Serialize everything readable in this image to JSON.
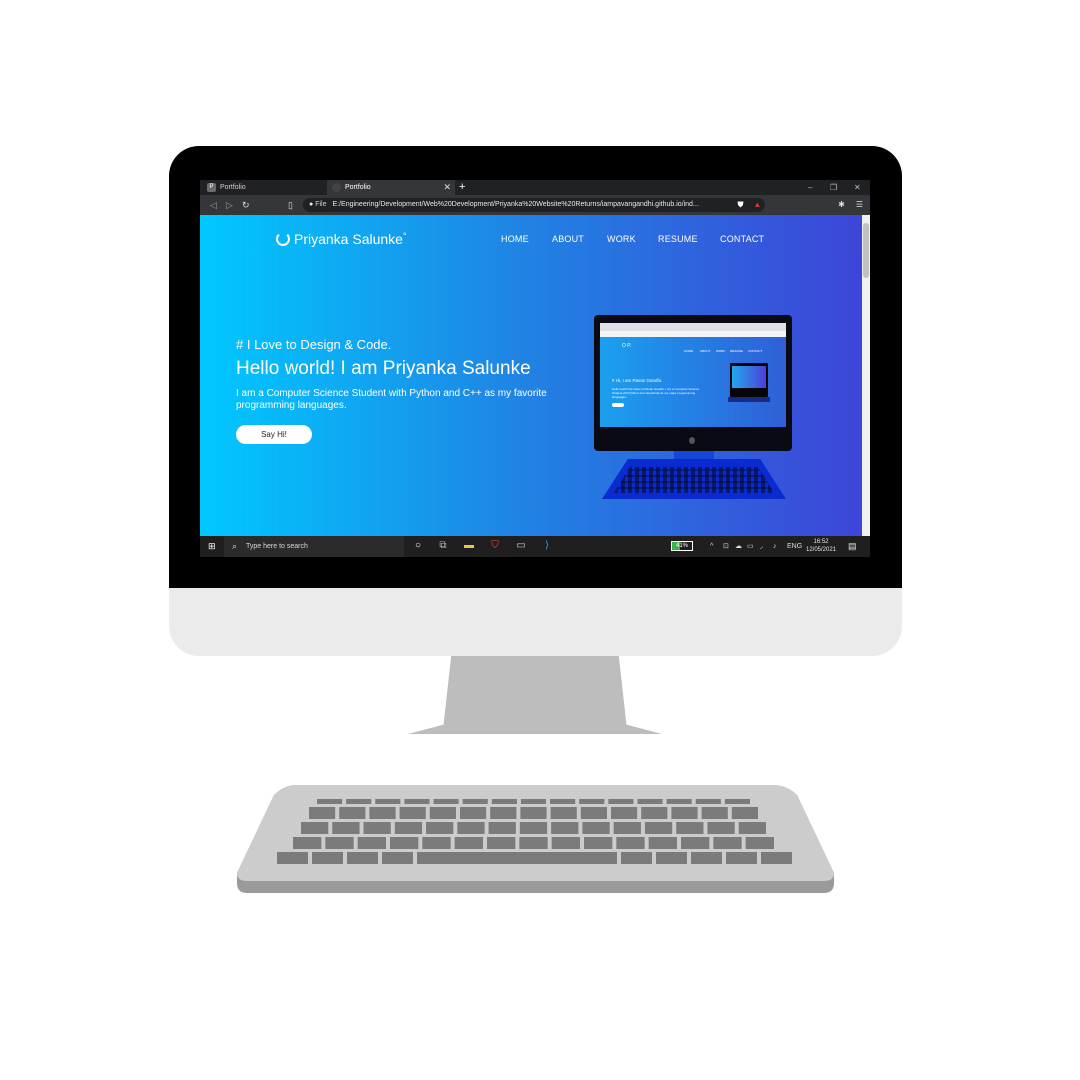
{
  "browser": {
    "tabs": [
      {
        "label": "Portfolio",
        "active": false
      },
      {
        "label": "Portfolio",
        "active": true
      }
    ],
    "new_tab": "+",
    "address": {
      "scheme_label": "File",
      "url": "E:/Engineering/Development/Web%20Development/Priyanka%20Website%20Returns/iampavangandhi.github.io/ind..."
    },
    "window_controls": [
      "–",
      "❐",
      "✕"
    ]
  },
  "page": {
    "logo": "Priyanka Salunke",
    "logo_suffix": "°",
    "nav": [
      "HOME",
      "ABOUT",
      "WORK",
      "RESUME",
      "CONTACT"
    ],
    "hero": {
      "kicker": "# I Love to Design & Code.",
      "title": "Hello world! I am Priyanka Salunke",
      "description": "I am a Computer Science Student with Python and C++ as my favorite programming languages.",
      "button": "Say Hi!"
    },
    "preview": {
      "kicker": "# Hi, I am Pavan Gandhi.",
      "description": "Hello world! My name is Pavan Gandhi. I am a Computer Science Student with Python and JavaScript as my major programming languages."
    }
  },
  "taskbar": {
    "search_placeholder": "Type here to search",
    "battery": "41%",
    "battery_level": 0.41,
    "language": "ENG",
    "time": "16:52",
    "date": "12/05/2021",
    "colors": {
      "battery": "#3bb34a",
      "taskbar": "#1f1f1f"
    }
  },
  "theme": {
    "gradient_start": "#00c8ff",
    "gradient_end": "#3d45d8"
  }
}
